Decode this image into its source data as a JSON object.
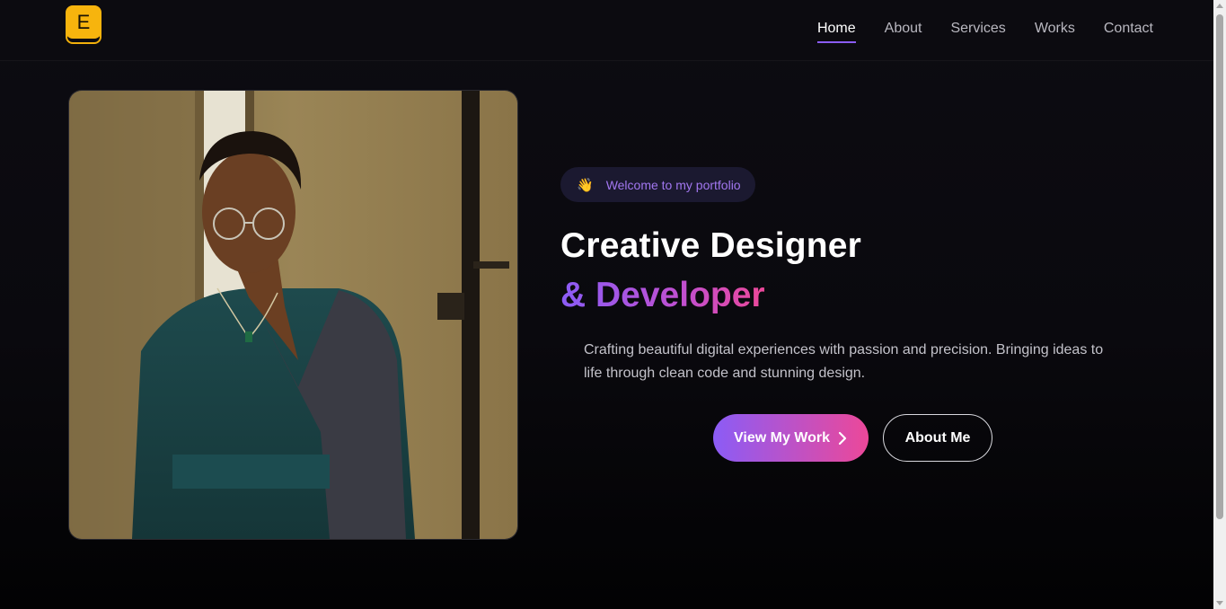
{
  "header": {
    "logo_letter": "E",
    "nav": [
      {
        "label": "Home",
        "active": true
      },
      {
        "label": "About",
        "active": false
      },
      {
        "label": "Services",
        "active": false
      },
      {
        "label": "Works",
        "active": false
      },
      {
        "label": "Contact",
        "active": false
      }
    ]
  },
  "hero": {
    "badge_icon": "waving-hand-icon",
    "badge_text": "Welcome to my portfolio",
    "title_line1": "Creative Designer",
    "title_line2": "& Developer",
    "description": "Crafting beautiful digital experiences with passion and precision. Bringing ideas to life through clean code and stunning design.",
    "primary_button": "View My Work",
    "secondary_button": "About Me"
  },
  "colors": {
    "accent_purple": "#8b5cf6",
    "accent_pink": "#ec4899",
    "logo_yellow": "#f7b40d",
    "background": "#0b0b0f"
  }
}
